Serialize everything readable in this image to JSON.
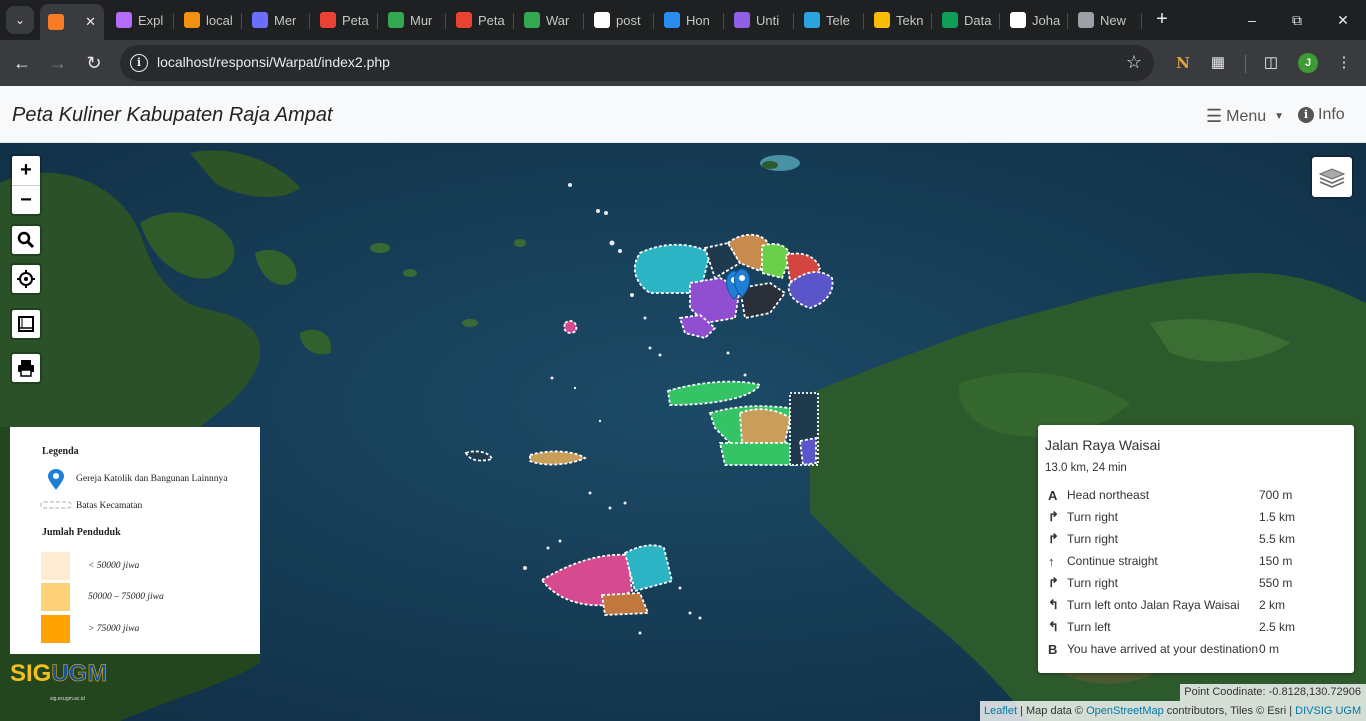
{
  "browser": {
    "tabs": [
      {
        "label": "",
        "icon": "xampp-icon",
        "color": "#fb7a24",
        "active": true
      },
      {
        "label": "Expl",
        "icon": "map-pin-purple-icon",
        "color": "#b56bff"
      },
      {
        "label": "local",
        "icon": "pma-icon",
        "color": "#f29111"
      },
      {
        "label": "Mer",
        "icon": "mer-icon",
        "color": "#6c6cff"
      },
      {
        "label": "Peta",
        "icon": "google-maps-pin-icon",
        "color": "#ea4335"
      },
      {
        "label": "Mur",
        "icon": "google-maps-icon",
        "color": "#34a853"
      },
      {
        "label": "Peta",
        "icon": "google-maps-pin-icon",
        "color": "#ea4335"
      },
      {
        "label": "War",
        "icon": "google-maps-icon",
        "color": "#34a853"
      },
      {
        "label": "post",
        "icon": "google-icon",
        "color": "#ffffff"
      },
      {
        "label": "Hon",
        "icon": "canva-icon",
        "color": "#2a8bf2"
      },
      {
        "label": "Unti",
        "icon": "colab-icon",
        "color": "#8f5fe8"
      },
      {
        "label": "Tele",
        "icon": "telegram-icon",
        "color": "#2aa3df"
      },
      {
        "label": "Tekn",
        "icon": "slides-icon",
        "color": "#fbbc04"
      },
      {
        "label": "Data",
        "icon": "sheets-icon",
        "color": "#0f9d58"
      },
      {
        "label": "Joha",
        "icon": "github-icon",
        "color": "#ffffff"
      },
      {
        "label": "New",
        "icon": "chrome-icon",
        "color": "#9aa0a6"
      }
    ],
    "url": "localhost/responsi/Warpat/index2.php",
    "profile_initial": "J"
  },
  "navbar": {
    "brand": "Peta Kuliner Kabupaten Raja Ampat",
    "menu_label": "Menu",
    "info_label": "Info"
  },
  "legend": {
    "title": "Legenda",
    "marker_label": "Gereja Katolik dan Bangunan  Lainnnya",
    "boundary_label": "Batas Kecamatan",
    "population_title": "Jumlah Penduduk",
    "classes": [
      {
        "label": "< 50000 jiwa",
        "color": "#fdebd2"
      },
      {
        "label": "50000  –  75000 jiwa",
        "color": "#fdd07a"
      },
      {
        "label": "> 75000 jiwa",
        "color": "#ffa300"
      }
    ]
  },
  "sigugm": {
    "logo_a": "SIG",
    "logo_b": "UGM",
    "site": "sig.ecugm.ac.id"
  },
  "routing": {
    "name": "Jalan Raya Waisai",
    "summary": "13.0 km, 24 min",
    "steps": [
      {
        "icon": "A",
        "text": "Head northeast",
        "distance": "700 m"
      },
      {
        "icon": "↱",
        "text": "Turn right",
        "distance": "1.5 km"
      },
      {
        "icon": "↱",
        "text": "Turn right",
        "distance": "5.5 km"
      },
      {
        "icon": "↑",
        "text": "Continue straight",
        "distance": "150 m"
      },
      {
        "icon": "↱",
        "text": "Turn right",
        "distance": "550 m"
      },
      {
        "icon": "↰",
        "text": "Turn left onto Jalan Raya Waisai",
        "distance": "2 km"
      },
      {
        "icon": "↰",
        "text": "Turn left",
        "distance": "2.5 km"
      },
      {
        "icon": "B",
        "text": "You have arrived at your destination",
        "distance": "0 m"
      }
    ]
  },
  "coordinates": "Point Coodinate: -0.8128,130.72906",
  "attribution": {
    "leaflet": "Leaflet",
    "sep1": " | Map data © ",
    "osm": "OpenStreetMap",
    "rest": " contributors, Tiles © Esri | ",
    "divsig": "DIVSIG UGM"
  },
  "colors": {
    "water": "#163a52",
    "land": "#2d5a2c",
    "marker": "#1f7fd6",
    "district_colors": [
      "#2bb5c4",
      "#c88a4d",
      "#6ad04a",
      "#d3453f",
      "#5a55c8",
      "#8f4fd0",
      "#c99d5a",
      "#34c466",
      "#d64a8f",
      "#c0783e"
    ]
  }
}
